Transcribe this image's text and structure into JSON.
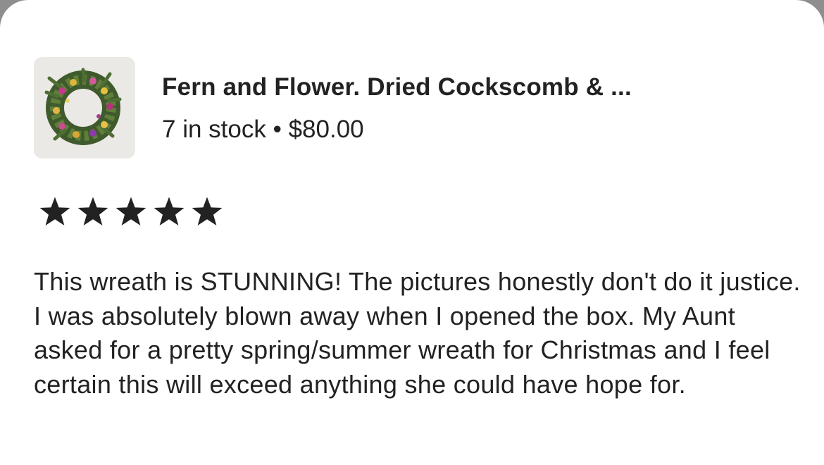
{
  "listing": {
    "image_alt": "wreath-thumbnail",
    "title": "Fern and Flower. Dried Cockscomb & ...",
    "stock": "7 in stock",
    "separator": "•",
    "price": "$80.00"
  },
  "rating": {
    "stars": 5,
    "max": 5,
    "icon": "star-filled-icon",
    "color": "#222222"
  },
  "review": {
    "text": "This wreath is STUNNING! The pictures honestly don't do it justice. I was absolutely blown away when I opened the box. My Aunt asked for a pretty spring/summer wreath for Christmas and I feel certain this will exceed anything she could have hope for."
  }
}
